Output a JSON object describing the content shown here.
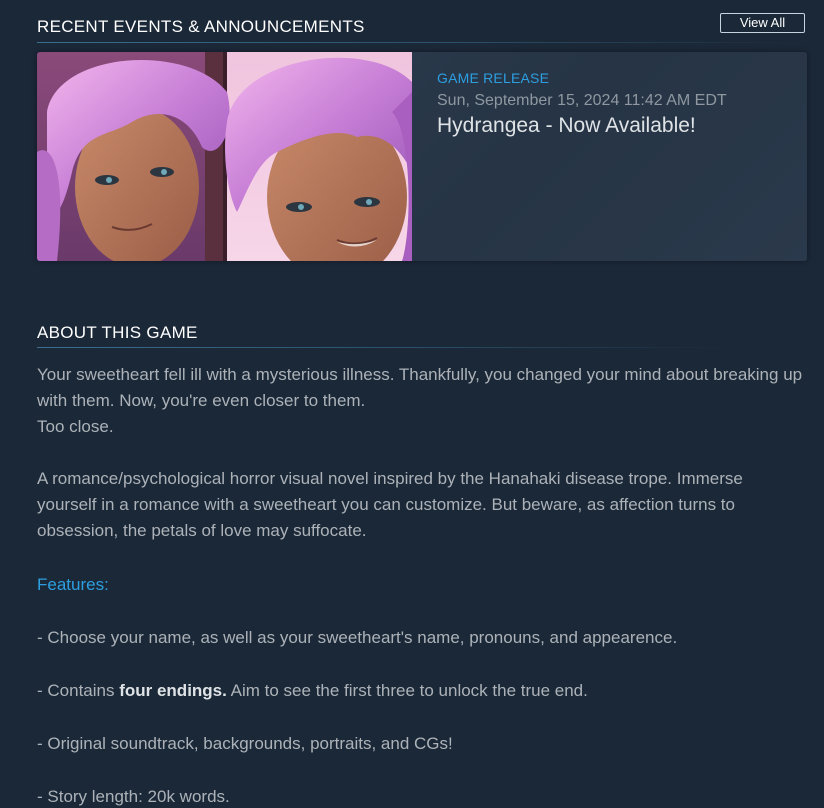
{
  "events": {
    "header": "RECENT EVENTS & ANNOUNCEMENTS",
    "view_all_label": "View All",
    "card": {
      "type": "GAME RELEASE",
      "date": "Sun, September 15, 2024 11:42 AM EDT",
      "title": "Hydrangea - Now Available!"
    }
  },
  "about": {
    "header": "ABOUT THIS GAME",
    "intro_line1": "Your sweetheart fell ill with a mysterious illness. Thankfully, you changed your mind about breaking up with them. Now, you're even closer to them.",
    "intro_line2": "Too close.",
    "description": "A romance/psychological horror visual novel inspired by the Hanahaki disease trope. Immerse yourself in a romance with a sweetheart you can customize. But beware, as affection turns to obsession, the petals of love may suffocate.",
    "features_title": "Features:",
    "feature1": "- Choose your name, as well as your sweetheart's name, pronouns, and appearence.",
    "feature2_prefix": "- Contains ",
    "feature2_bold": "four endings.",
    "feature2_suffix": " Aim to see the first three to unlock the true end.",
    "feature3": "- Original soundtrack, backgrounds, portraits, and CGs!",
    "feature4": "- Story length: 20k words."
  },
  "colors": {
    "background": "#1b2838",
    "accent_blue": "#2d9fe0",
    "body_text": "#acb2b8"
  }
}
